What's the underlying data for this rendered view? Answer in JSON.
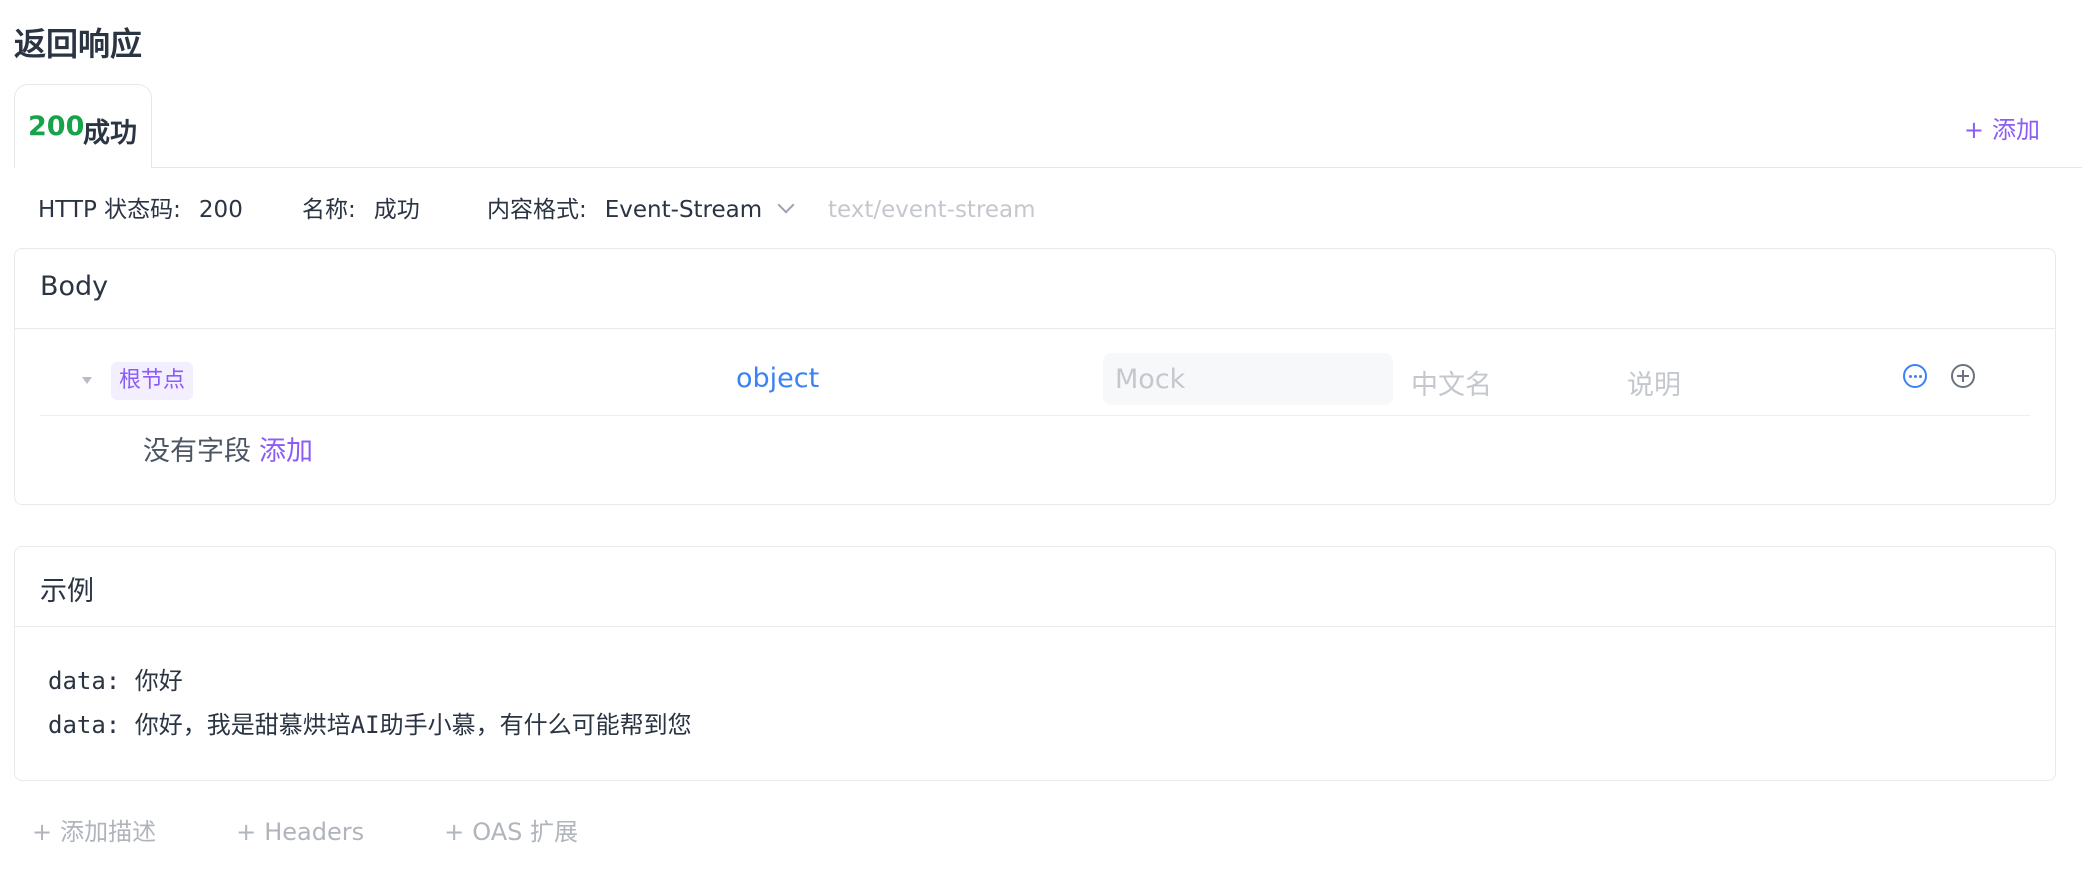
{
  "title": "返回响应",
  "tab": {
    "code": "200",
    "label": "成功"
  },
  "add_response": {
    "plus": "+",
    "label": "添加"
  },
  "meta": {
    "status_key": "HTTP 状态码:",
    "status_value": "200",
    "name_key": "名称:",
    "name_value": "成功",
    "format_key": "内容格式:",
    "format_value": "Event-Stream",
    "mime": "text/event-stream"
  },
  "body": {
    "title": "Body",
    "root_label": "根节点",
    "type": "object",
    "mock_placeholder": "Mock",
    "cn_name_placeholder": "中文名",
    "desc_placeholder": "说明",
    "no_fields": "没有字段",
    "add_link": "添加"
  },
  "example": {
    "title": "示例",
    "lines": [
      "data: 你好",
      "data: 你好，我是甜慕烘培AI助手小慕，有什么可能帮到您"
    ]
  },
  "footer": {
    "plus": "+",
    "add_desc": "添加描述",
    "headers": "Headers",
    "oas": "OAS 扩展"
  },
  "colors": {
    "success": "#16a34a",
    "accent": "#8b5cf6",
    "link_blue": "#3b82f6"
  },
  "icons": [
    "chevron-down-icon",
    "caret-down-icon",
    "more-icon",
    "plus-circle-icon",
    "plus-icon"
  ]
}
